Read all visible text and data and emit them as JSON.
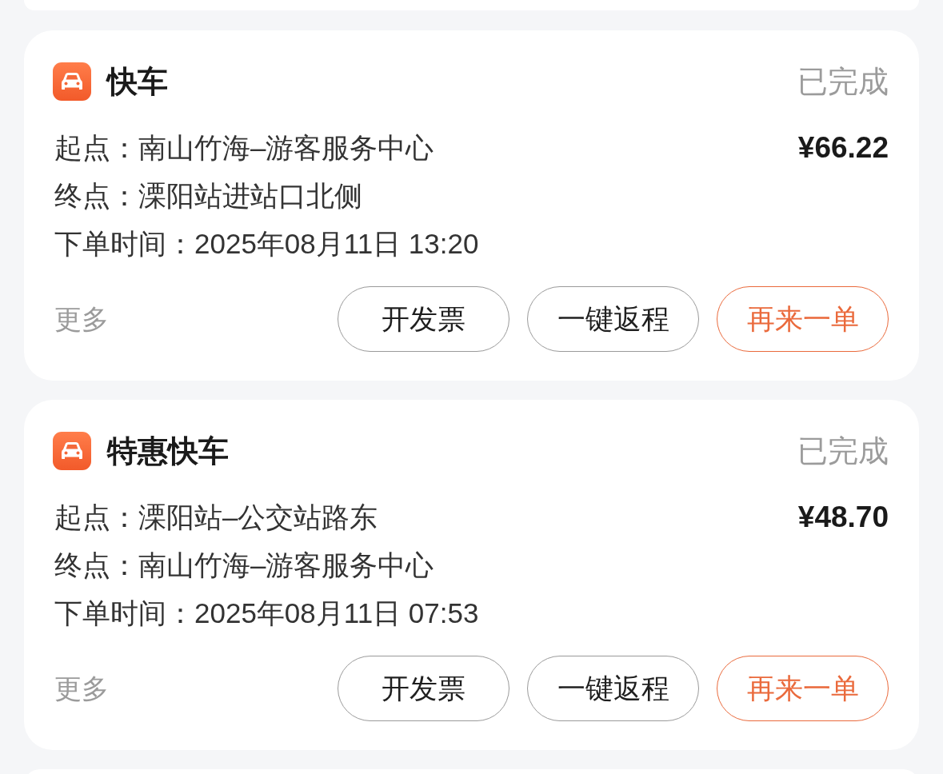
{
  "orders": [
    {
      "service": "快车",
      "status": "已完成",
      "details": [
        "起点：南山竹海–游客服务中心",
        "终点：溧阳站进站口北侧",
        "下单时间：2025年08月11日 13:20"
      ],
      "price": "¥66.22",
      "more": "更多",
      "buttons": [
        {
          "label": "开发票",
          "kind": "default"
        },
        {
          "label": "一键返程",
          "kind": "default"
        },
        {
          "label": "再来一单",
          "kind": "primary"
        }
      ]
    },
    {
      "service": "特惠快车",
      "status": "已完成",
      "details": [
        "起点：溧阳站–公交站路东",
        "终点：南山竹海–游客服务中心",
        "下单时间：2025年08月11日 07:53"
      ],
      "price": "¥48.70",
      "more": "更多",
      "buttons": [
        {
          "label": "开发票",
          "kind": "default"
        },
        {
          "label": "一键返程",
          "kind": "default"
        },
        {
          "label": "再来一单",
          "kind": "primary"
        }
      ]
    }
  ]
}
